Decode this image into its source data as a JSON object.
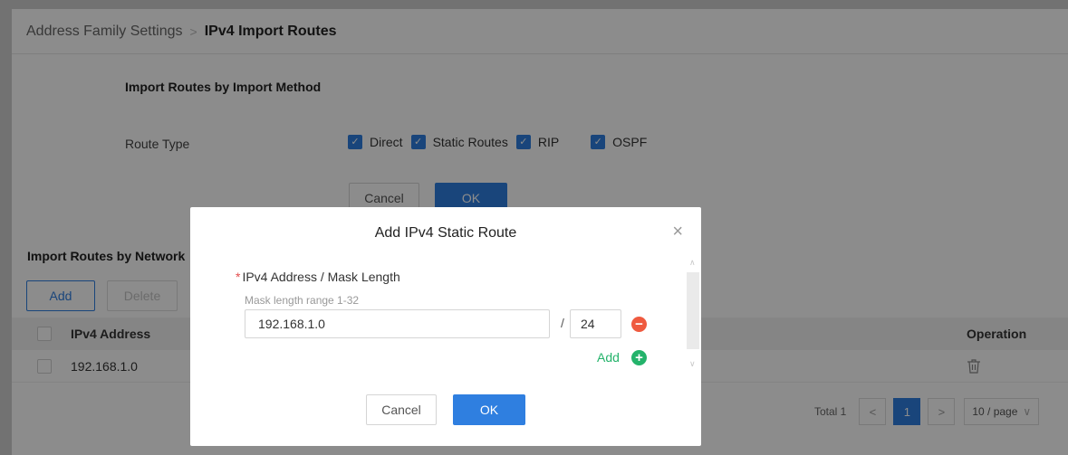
{
  "breadcrumb": {
    "parent": "Address Family Settings",
    "separator": ">",
    "current": "IPv4 Import Routes"
  },
  "import_method": {
    "title": "Import Routes by Import Method",
    "route_type_label": "Route Type",
    "options": [
      {
        "label": "Direct",
        "checked": true
      },
      {
        "label": "Static Routes",
        "checked": true
      },
      {
        "label": "RIP",
        "checked": true
      },
      {
        "label": "OSPF",
        "checked": true
      }
    ],
    "cancel_label": "Cancel",
    "ok_label": "OK"
  },
  "import_network": {
    "title": "Import Routes by Network",
    "add_label": "Add",
    "delete_label": "Delete",
    "columns": {
      "address": "IPv4 Address",
      "operation": "Operation"
    },
    "rows": [
      {
        "address": "192.168.1.0"
      }
    ],
    "pagination": {
      "total": "Total 1",
      "prev": "<",
      "page": "1",
      "next": ">",
      "page_size": "10 / page"
    }
  },
  "modal": {
    "title": "Add IPv4 Static Route",
    "close_glyph": "×",
    "field_label": "IPv4 Address / Mask Length",
    "required_mark": "*",
    "hint": "Mask length range 1-32",
    "ip_value": "192.168.1.0",
    "slash": "/",
    "mask_value": "24",
    "add_label": "Add",
    "cancel_label": "Cancel",
    "ok_label": "OK"
  },
  "colors": {
    "primary": "#2f7fe0",
    "danger": "#ef5a3f",
    "success": "#24b36b"
  }
}
